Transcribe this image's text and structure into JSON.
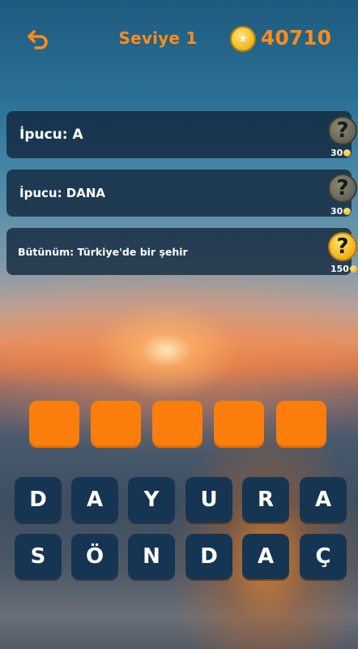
{
  "header": {
    "back_icon": "back-arrow-icon",
    "level_title": "Seviye 1",
    "coin_icon": "star-coin-icon",
    "coins": "40710"
  },
  "colors": {
    "accent_orange": "#ff8c1a",
    "slot_orange": "#fb7e0c",
    "key_navy": "#163552",
    "hint_bg": "#102438"
  },
  "hints": [
    {
      "text": "İpucu: A",
      "price": "30",
      "state": "locked",
      "icon": "question-mark-icon"
    },
    {
      "text": "İpucu: DANA",
      "price": "30",
      "state": "locked",
      "icon": "question-mark-icon"
    },
    {
      "text": "Bütünüm: Türkiye'de bir şehir",
      "price": "150",
      "state": "active",
      "icon": "question-mark-icon"
    }
  ],
  "answer": {
    "length": 5,
    "slots": [
      "",
      "",
      "",
      "",
      ""
    ]
  },
  "letters": {
    "row1": [
      "D",
      "A",
      "Y",
      "U",
      "R",
      "A"
    ],
    "row2": [
      "S",
      "Ö",
      "N",
      "D",
      "A",
      "Ç"
    ]
  }
}
